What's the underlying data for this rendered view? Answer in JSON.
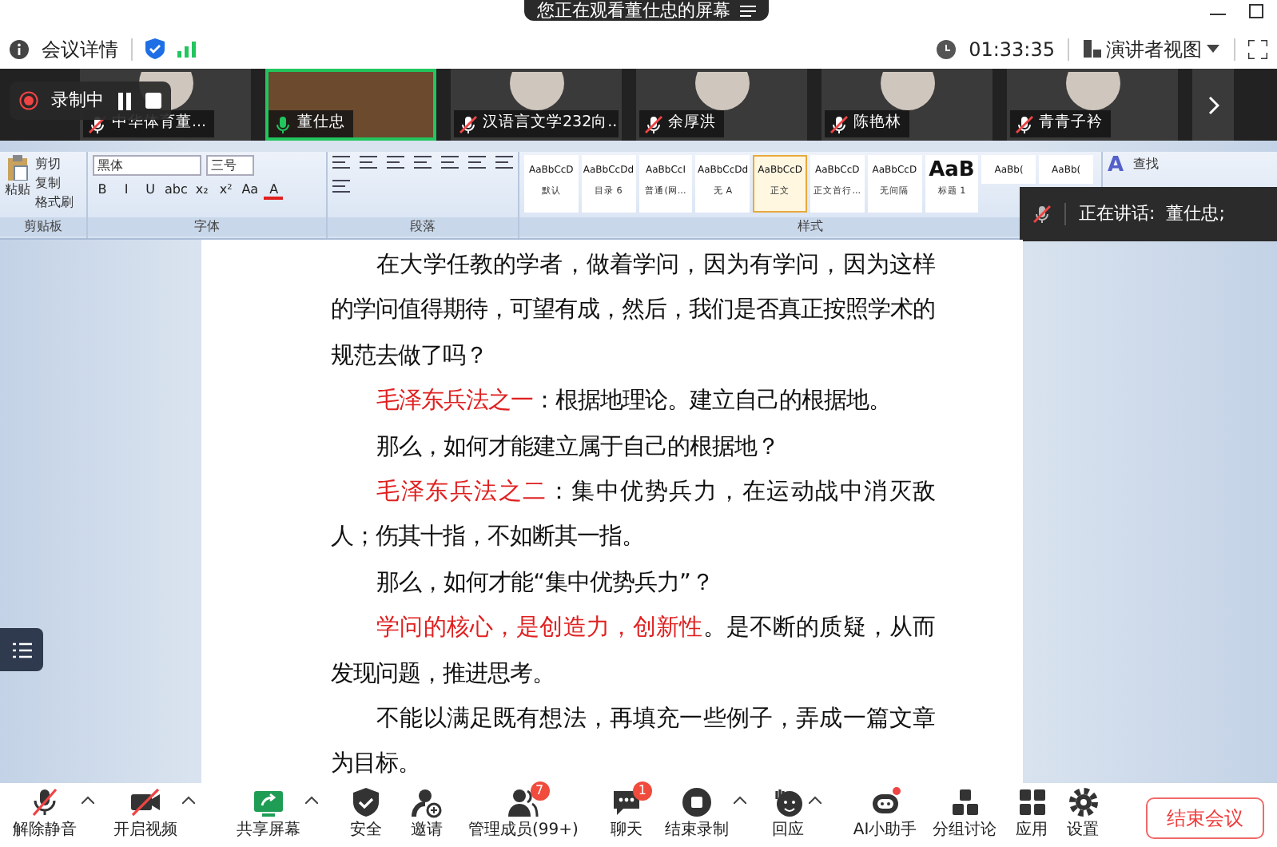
{
  "top_banner": {
    "text": "您正在观看董仕忠的屏幕"
  },
  "info_bar": {
    "meeting_details": "会议详情",
    "timer": "01:33:35",
    "view_mode": "演讲者视图"
  },
  "recording": {
    "label": "录制中"
  },
  "participants": [
    {
      "name": "中华体育董...",
      "muted": true,
      "selected": false
    },
    {
      "name": "董仕忠",
      "muted": false,
      "selected": true
    },
    {
      "name": "汉语言文学232向...",
      "muted": true,
      "selected": false
    },
    {
      "name": "余厚洪",
      "muted": true,
      "selected": false
    },
    {
      "name": "陈艳林",
      "muted": true,
      "selected": false
    },
    {
      "name": "青青子衿",
      "muted": true,
      "selected": false
    }
  ],
  "ribbon": {
    "paste": "粘贴",
    "clipboard_items": [
      "剪切",
      "复制",
      "格式刷"
    ],
    "font_name": "黑体",
    "font_size": "三号",
    "font_tools": [
      "B",
      "I",
      "U",
      "abc",
      "x₂",
      "x²",
      "Aa"
    ],
    "font_color": "A",
    "change_styles": "A",
    "styles": [
      {
        "preview": "AaBbCcD",
        "label": "默认",
        "selected": false
      },
      {
        "preview": "AaBbCcDd",
        "label": "目录 6",
        "selected": false
      },
      {
        "preview": "AaBbCcI",
        "label": "普通(网...",
        "selected": false
      },
      {
        "preview": "AaBbCcDd",
        "label": "无 A",
        "selected": false
      },
      {
        "preview": "AaBbCcD",
        "label": "正文",
        "selected": true
      },
      {
        "preview": "AaBbCcD",
        "label": "正文首行...",
        "selected": false
      },
      {
        "preview": "AaBbCcD",
        "label": "无间隔",
        "selected": false
      },
      {
        "preview": "AaB",
        "label": "标题 1",
        "selected": false
      },
      {
        "preview": "AaBb(",
        "selected": false
      },
      {
        "preview": "AaBb(",
        "selected": false
      }
    ],
    "find": "查找",
    "groups": [
      "剪贴板",
      "字体",
      "段落",
      "样式"
    ]
  },
  "speaking": {
    "text": "正在讲话:  董仕忠;"
  },
  "document": {
    "paragraphs": [
      {
        "segments": [
          {
            "text": "在大学任教的学者，做着学问，因为有学问，因为这样的学问值得期待，可望有成，然后，我们是否真正按照学术的规范去做了吗？",
            "highlighted": false
          }
        ]
      },
      {
        "segments": [
          {
            "text": "毛泽东兵法之一",
            "highlighted": true
          },
          {
            "text": "：根据地理论。建立自己的根据地。",
            "highlighted": false
          }
        ]
      },
      {
        "segments": [
          {
            "text": "那么，如何才能建立属于自己的根据地？",
            "highlighted": false
          }
        ]
      },
      {
        "segments": [
          {
            "text": "毛泽东兵法之二",
            "highlighted": true
          },
          {
            "text": "：集中优势兵力，在运动战中消灭敌人；伤其十指，不如断其一指。",
            "highlighted": false
          }
        ]
      },
      {
        "segments": [
          {
            "text": "那么，如何才能“集中优势兵力”？",
            "highlighted": false
          }
        ]
      },
      {
        "segments": [
          {
            "text": "学问的核心，是创造力，创新性",
            "highlighted": true
          },
          {
            "text": "。是不断的质疑，从而发现问题，推进思考。",
            "highlighted": false
          }
        ]
      },
      {
        "segments": [
          {
            "text": "不能以满足既有想法，再填充一些例子，弄成一篇文章为目标。",
            "highlighted": false
          }
        ]
      }
    ]
  },
  "toolbar": {
    "items": [
      {
        "kind": "mic",
        "label": "解除静音",
        "caret": true
      },
      {
        "kind": "camera",
        "label": "开启视频",
        "caret": true
      },
      {
        "kind": "share",
        "label": "共享屏幕",
        "caret": true
      },
      {
        "kind": "shield",
        "label": "安全",
        "caret": false
      },
      {
        "kind": "invite",
        "label": "邀请",
        "caret": false
      },
      {
        "kind": "members",
        "label": "管理成员(99+)",
        "caret": false,
        "badge": "7"
      },
      {
        "kind": "chat",
        "label": "聊天",
        "caret": false,
        "badge": "1"
      },
      {
        "kind": "record",
        "label": "结束录制",
        "caret": true
      },
      {
        "kind": "hand",
        "label": "回应",
        "caret": true
      },
      {
        "kind": "robot",
        "label": "AI小助手",
        "caret": false
      },
      {
        "kind": "groups",
        "label": "分组讨论",
        "caret": false
      },
      {
        "kind": "apps",
        "label": "应用",
        "caret": false
      },
      {
        "kind": "gear",
        "label": "设置",
        "caret": false
      }
    ],
    "end_button": "结束会议"
  }
}
